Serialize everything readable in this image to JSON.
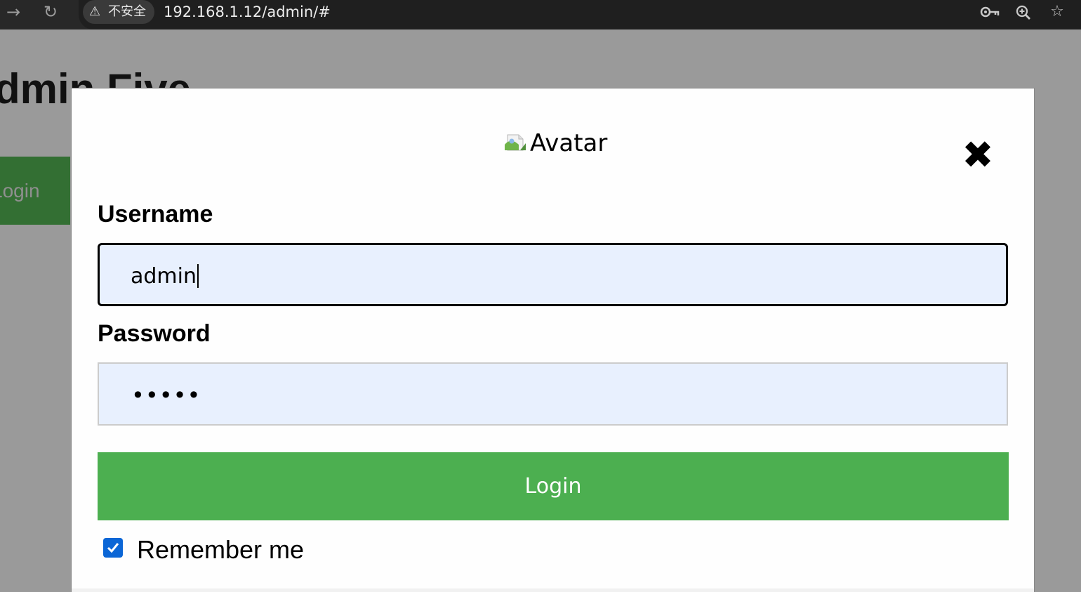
{
  "browser": {
    "security_warning_icon": "warning-triangle-icon",
    "security_label": "不安全",
    "url": "192.168.1.12/admin/#",
    "icons": [
      "forward-arrow-icon",
      "reload-icon",
      "password-key-icon",
      "zoom-icon",
      "bookmark-star-icon"
    ]
  },
  "page": {
    "heading": "dmin Five",
    "login_button": "Login"
  },
  "modal": {
    "avatar_alt": "Avatar",
    "close_symbol": "✖",
    "username_label": "Username",
    "username_value": "admin",
    "password_label": "Password",
    "password_value": "•••••",
    "submit_label": "Login",
    "remember_label": "Remember me",
    "remember_checked": true
  },
  "colors": {
    "accent_green": "#4caf50",
    "input_bg": "#e8f0fe",
    "checkbox_blue": "#0b66d6",
    "overlay_gray": "#9a9a9a"
  }
}
